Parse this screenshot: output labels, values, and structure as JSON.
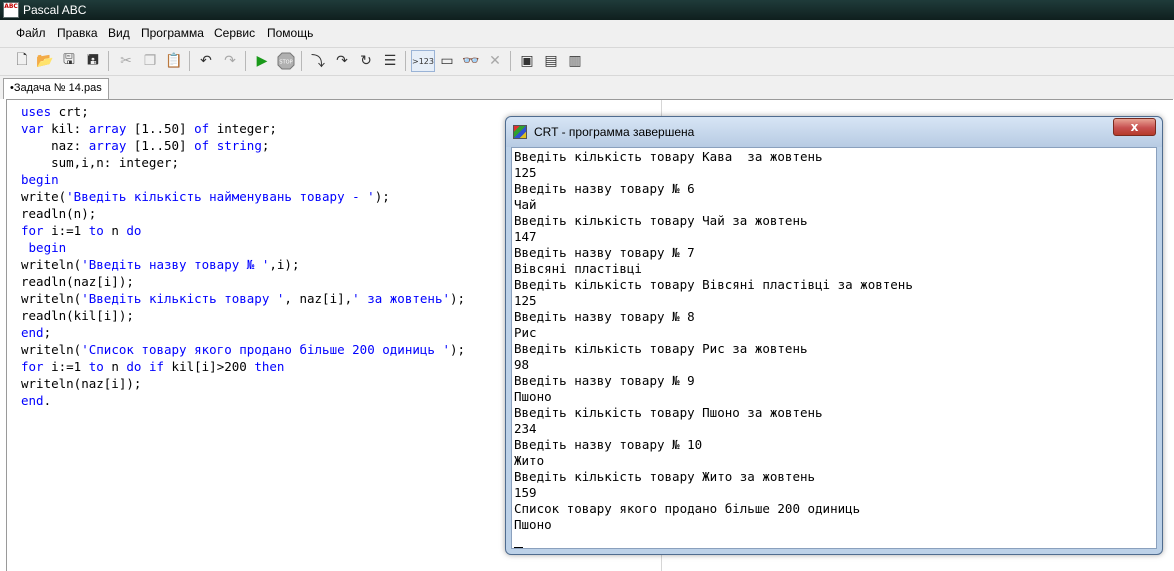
{
  "window": {
    "title": "Pascal ABC",
    "icon_text": "ABC"
  },
  "menu": [
    "Файл",
    "Правка",
    "Вид",
    "Программа",
    "Сервис",
    "Помощь"
  ],
  "toolbar": {
    "icons": [
      "new-file-icon",
      "open-folder-icon",
      "save-icon",
      "save-all-icon",
      "cut-icon",
      "copy-icon",
      "paste-icon",
      "undo-icon",
      "redo-icon",
      "run-icon",
      "stop-icon",
      "step-into-icon",
      "step-over-icon",
      "step-out-icon",
      "breakpoint-icon",
      "output-window-icon",
      "console-window-icon",
      "watch-icon",
      "close-x-icon",
      "tool-a-icon",
      "tool-b-icon",
      "tool-c-icon"
    ],
    "pressed_label": ">123"
  },
  "tab": {
    "label": "•Задача № 14.pas"
  },
  "editor": {
    "lines": [
      [
        {
          "t": "uses",
          "c": "kw"
        },
        {
          "t": " crt;",
          "c": ""
        }
      ],
      [
        {
          "t": "var",
          "c": "kw"
        },
        {
          "t": " kil: ",
          "c": ""
        },
        {
          "t": "array",
          "c": "kw"
        },
        {
          "t": " [1..50] ",
          "c": ""
        },
        {
          "t": "of",
          "c": "kw"
        },
        {
          "t": " integer;",
          "c": ""
        }
      ],
      [
        {
          "t": "    naz: ",
          "c": ""
        },
        {
          "t": "array",
          "c": "kw"
        },
        {
          "t": " [1..50] ",
          "c": ""
        },
        {
          "t": "of",
          "c": "kw"
        },
        {
          "t": " ",
          "c": ""
        },
        {
          "t": "string",
          "c": "kw"
        },
        {
          "t": ";",
          "c": ""
        }
      ],
      [
        {
          "t": "    sum,i,n: integer;",
          "c": ""
        }
      ],
      [
        {
          "t": "begin",
          "c": "kw"
        }
      ],
      [
        {
          "t": "write(",
          "c": ""
        },
        {
          "t": "'Введіть кількість найменувань товару - '",
          "c": "str"
        },
        {
          "t": ");",
          "c": ""
        }
      ],
      [
        {
          "t": "readln(n);",
          "c": ""
        }
      ],
      [
        {
          "t": "for",
          "c": "kw"
        },
        {
          "t": " i:=1 ",
          "c": ""
        },
        {
          "t": "to",
          "c": "kw"
        },
        {
          "t": " n ",
          "c": ""
        },
        {
          "t": "do",
          "c": "kw"
        }
      ],
      [
        {
          "t": " begin",
          "c": "kw"
        }
      ],
      [
        {
          "t": "writeln(",
          "c": ""
        },
        {
          "t": "'Введіть назву товару № '",
          "c": "str"
        },
        {
          "t": ",i);",
          "c": ""
        }
      ],
      [
        {
          "t": "readln(naz[i]);",
          "c": ""
        }
      ],
      [
        {
          "t": "writeln(",
          "c": ""
        },
        {
          "t": "'Введіть кількість товару '",
          "c": "str"
        },
        {
          "t": ", naz[i],",
          "c": ""
        },
        {
          "t": "' за жовтень'",
          "c": "str"
        },
        {
          "t": ");",
          "c": ""
        }
      ],
      [
        {
          "t": "readln(kil[i]);",
          "c": ""
        }
      ],
      [
        {
          "t": "end",
          "c": "kw"
        },
        {
          "t": ";",
          "c": ""
        }
      ],
      [
        {
          "t": "writeln(",
          "c": ""
        },
        {
          "t": "'Список товару якого продано більше 200 одиниць '",
          "c": "str"
        },
        {
          "t": ");",
          "c": ""
        }
      ],
      [
        {
          "t": "for",
          "c": "kw"
        },
        {
          "t": " i:=1 ",
          "c": ""
        },
        {
          "t": "to",
          "c": "kw"
        },
        {
          "t": " n ",
          "c": ""
        },
        {
          "t": "do",
          "c": "kw"
        },
        {
          "t": " ",
          "c": ""
        },
        {
          "t": "if",
          "c": "kw"
        },
        {
          "t": " kil[i]>200 ",
          "c": ""
        },
        {
          "t": "then",
          "c": "kw"
        }
      ],
      [
        {
          "t": "writeln(naz[i]);",
          "c": ""
        }
      ],
      [
        {
          "t": "end",
          "c": "kw"
        },
        {
          "t": ".",
          "c": ""
        }
      ]
    ]
  },
  "crt": {
    "title": "CRT - программа завершена",
    "close_label": "x",
    "output": [
      "Введіть кількість товару Кава  за жовтень",
      "125",
      "Введіть назву товару № 6",
      "Чай",
      "Введіть кількість товару Чай за жовтень",
      "147",
      "Введіть назву товару № 7",
      "Вівсяні пластівці",
      "Введіть кількість товару Вівсяні пластівці за жовтень",
      "125",
      "Введіть назву товару № 8",
      "Рис",
      "Введіть кількість товару Рис за жовтень",
      "98",
      "Введіть назву товару № 9",
      "Пшоно",
      "Введіть кількість товару Пшоно за жовтень",
      "234",
      "Введіть назву товару № 10",
      "Жито",
      "Введіть кількість товару Жито за жовтень",
      "159",
      "Список товару якого продано більше 200 одиниць",
      "Пшоно"
    ]
  }
}
